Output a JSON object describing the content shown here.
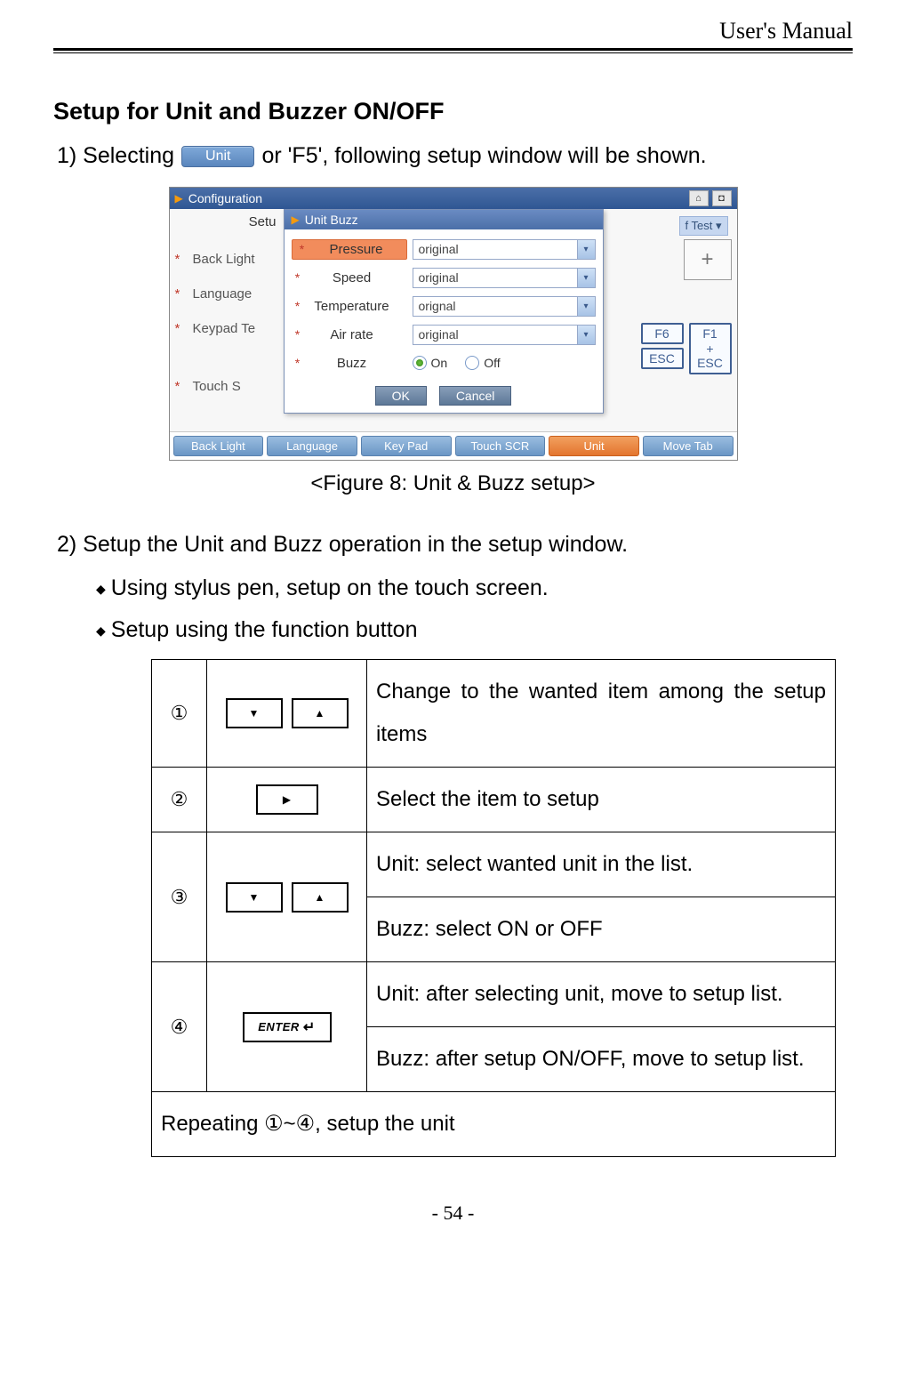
{
  "header": {
    "title": "User's Manual"
  },
  "section": {
    "title": "Setup for Unit and Buzzer ON/OFF"
  },
  "line1": {
    "prefix": "1) Selecting ",
    "btn": "Unit",
    "suffix": " or 'F5', following setup window will be shown."
  },
  "screenshot": {
    "titlebar": "Configuration",
    "left": {
      "setu": "Setu",
      "items": [
        "Back Light",
        "Language",
        "Keypad Te",
        "Touch S"
      ]
    },
    "dialog": {
      "title": "Unit  Buzz",
      "rows": [
        {
          "label": "Pressure",
          "value": "original"
        },
        {
          "label": "Speed",
          "value": "original"
        },
        {
          "label": "Temperature",
          "value": "orignal"
        },
        {
          "label": "Air rate",
          "value": "original"
        }
      ],
      "buzz_label": "Buzz",
      "on": "On",
      "off": "Off",
      "ok": "OK",
      "cancel": "Cancel"
    },
    "right": {
      "ftest": "f Test",
      "f6": "F6",
      "esc": "ESC",
      "f1esc": "F1\n+\nESC"
    },
    "bottom": [
      "Back Light",
      "Language",
      "Key Pad",
      "Touch SCR",
      "Unit",
      "Move Tab"
    ]
  },
  "caption": "<Figure 8: Unit & Buzz setup>",
  "step2": "2) Setup the Unit and Buzz operation in the setup window.",
  "bullets": [
    "Using stylus pen, setup on the touch screen.",
    "Setup using the function button"
  ],
  "table": {
    "rows": [
      {
        "num": "①",
        "desc": [
          "Change to the wanted item among the setup items"
        ]
      },
      {
        "num": "②",
        "desc": [
          "Select the item to setup"
        ]
      },
      {
        "num": "③",
        "desc": [
          "Unit: select wanted unit in the list.",
          "Buzz: select ON or OFF"
        ]
      },
      {
        "num": "④",
        "desc": [
          "Unit: after selecting unit, move to setup list.",
          "Buzz: after setup ON/OFF, move to setup list."
        ]
      }
    ],
    "footer": "Repeating ①~④, setup the unit",
    "enter_label": "ENTER"
  },
  "page_number": "- 54 -"
}
